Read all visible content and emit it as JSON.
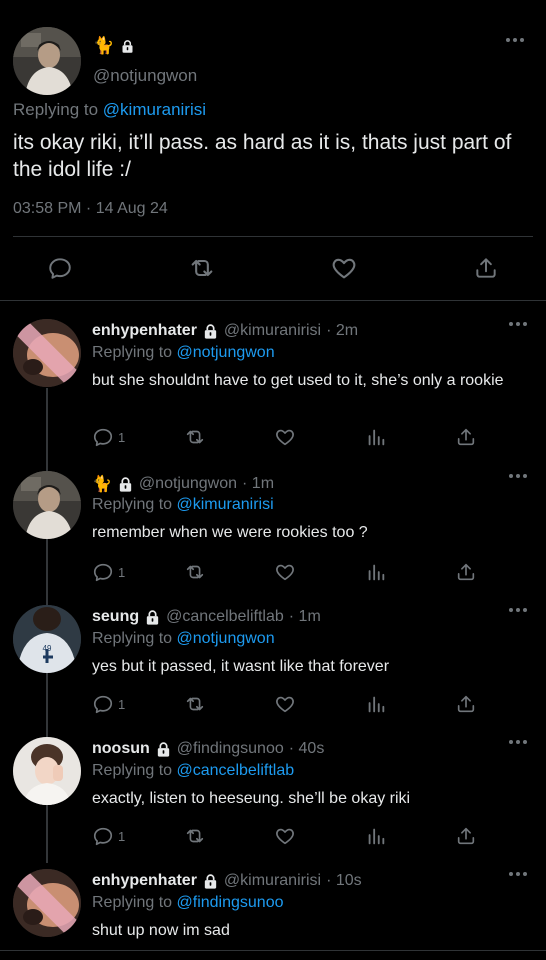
{
  "main_tweet": {
    "display_name": "🐈",
    "handle": "@notjungwon",
    "replying_label": "Replying to",
    "replying_to": "@kimuranirisi",
    "text": "its okay riki, it’ll pass. as hard as it is, thats just part of the idol life :/",
    "timestamp": "03:58 PM · 14 Aug 24"
  },
  "replies": [
    {
      "display_name": "enhypenhater",
      "handle": "@kimuranirisi",
      "time": "· 2m",
      "replying_label": "Replying to",
      "replying_to": "@notjungwon",
      "text": "but she shouldnt have to get used to it, she’s only a rookie",
      "reply_count": "1"
    },
    {
      "display_name": "🐈",
      "handle": "@notjungwon",
      "time": "· 1m",
      "replying_label": "Replying to",
      "replying_to": "@kimuranirisi",
      "text": "remember when we were rookies too ?",
      "reply_count": "1"
    },
    {
      "display_name": "seung",
      "handle": "@cancelbeliftlab",
      "time": "· 1m",
      "replying_label": "Replying to",
      "replying_to": "@notjungwon",
      "text": "yes but it passed, it wasnt like that forever",
      "reply_count": "1"
    },
    {
      "display_name": "noosun",
      "handle": "@findingsunoo",
      "time": "· 40s",
      "replying_label": "Replying to",
      "replying_to": "@cancelbeliftlab",
      "text": "exactly, listen to heeseung. she’ll be okay riki",
      "reply_count": "1"
    },
    {
      "display_name": "enhypenhater",
      "handle": "@kimuranirisi",
      "time": "· 10s",
      "replying_label": "Replying to",
      "replying_to": "@findingsunoo",
      "text": "shut up now im sad"
    }
  ],
  "colors": {
    "background": "#000000",
    "text": "#e7e9ea",
    "muted": "#71767b",
    "link": "#1d9bf0",
    "divider": "#2f3336"
  },
  "icons": [
    "lock-icon",
    "more-icon",
    "reply-icon",
    "retweet-icon",
    "like-icon",
    "share-icon",
    "analytics-icon"
  ]
}
